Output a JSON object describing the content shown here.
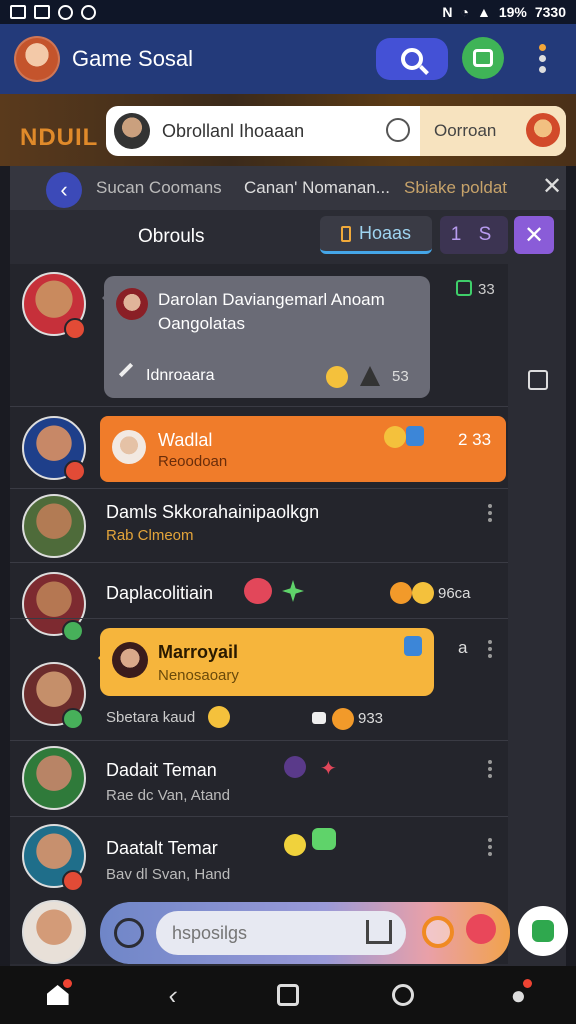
{
  "status_bar": {
    "battery": "19%",
    "time": "7330",
    "network": "N"
  },
  "header": {
    "title": "Game Sosal"
  },
  "banner": {
    "game_logo": "NDUIL"
  },
  "top_pill": {
    "text": "Obrollanl Ihoaaan",
    "right_label": "Oorroan"
  },
  "tabs": {
    "items": [
      "Sucan Coomans",
      "Canan' Nomanan...",
      "Sbiake poldat"
    ]
  },
  "subheader": {
    "title": "Obrouls",
    "active_button": "Hoaas",
    "counter": "1 S"
  },
  "messages": [
    {
      "bubble_title": "Darolan Daviangemarl Anoam Oangolatas",
      "bubble_footer": "Idnroaara",
      "bubble_count": "53",
      "side_count": "33"
    },
    {
      "title": "Wadlal",
      "subtitle": "Reoodoan",
      "count": "2 33"
    },
    {
      "title": "Damls Skkorahainipaolkgn",
      "subtitle": "Rab Clmeom"
    },
    {
      "title": "Daplacolitiain",
      "count": "96ca"
    },
    {
      "bubble_title": "Marroyail",
      "bubble_subtitle": "Nenosaoary",
      "footer": "Sbetara kaud",
      "count": "933",
      "side_label": "a"
    },
    {
      "title": "Dadait Teman",
      "subtitle": "Rae dc Van, Atand"
    },
    {
      "title": "Daatalt Temar",
      "subtitle": "Bav dl Svan, Hand"
    }
  ],
  "composer": {
    "placeholder": "hsposilgs"
  },
  "colors": {
    "accent": "#4451d6",
    "orange": "#f07c2a",
    "yellow": "#f6b53c",
    "purple": "#8a5cd8"
  },
  "icons": [
    "search-icon",
    "gamepad-icon",
    "more-icon",
    "back-icon",
    "close-icon",
    "home-icon",
    "back-nav-icon",
    "square-icon",
    "search-nav-icon",
    "profile-icon"
  ]
}
